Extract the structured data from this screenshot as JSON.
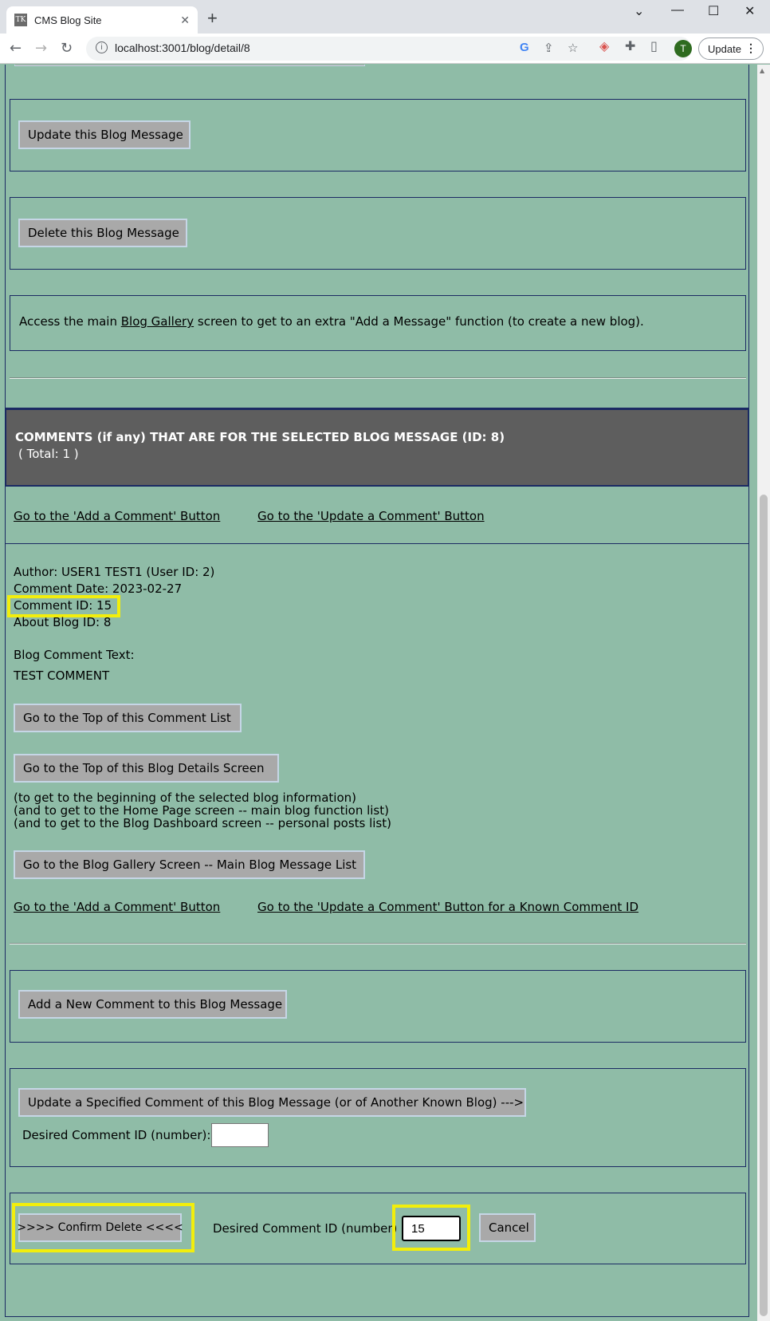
{
  "browser": {
    "tab_favicon": "TK",
    "tab_title": "CMS Blog Site",
    "tab_close": "✕",
    "new_tab": "+",
    "url": "localhost:3001/blog/detail/8",
    "profile_initial": "T",
    "update_label": "Update",
    "window_controls": [
      "⌄",
      "—",
      "☐",
      "✕"
    ]
  },
  "blog_actions": {
    "update_button": "Update this Blog Message",
    "delete_button": "Delete this Blog Message",
    "gallery_text_before": "Access the main ",
    "gallery_link": "Blog Gallery",
    "gallery_text_after": " screen to get to an extra \"Add a Message\" function (to create a new blog)."
  },
  "comments_header": {
    "title": "COMMENTS (if any) THAT ARE FOR THE SELECTED BLOG MESSAGE (ID: 8)",
    "total": "( Total: 1 )"
  },
  "top_links": {
    "add_comment": "Go to the 'Add a Comment' Button ",
    "update_comment": "Go to the 'Update a Comment' Button"
  },
  "comment": {
    "author": "Author: USER1 TEST1 (User ID: 2)",
    "date": "Comment Date: 2023-02-27",
    "comment_id": "Comment ID: 15",
    "blog_id": "About Blog ID: 8",
    "text_label": "Blog Comment Text:",
    "text": "TEST COMMENT"
  },
  "nav": {
    "top_of_comments": "Go to the Top of this Comment List",
    "top_of_blog": "Go to the Top of this Blog Details Screen",
    "note_1": "(to get to the beginning of the selected blog information)",
    "note_2": "(and to get to the Home Page screen -- main blog function list)",
    "note_3": "(and to get to the Blog Dashboard screen -- personal posts list)",
    "gallery_button": "Go to the Blog Gallery Screen -- Main Blog Message List"
  },
  "bottom_links": {
    "add_comment": "Go to the 'Add a Comment' Button ",
    "update_comment": "Go to the 'Update a Comment' Button for a Known Comment ID"
  },
  "add_comment": {
    "button": "Add a New Comment to this Blog Message"
  },
  "update_comment": {
    "button": "Update a Specified Comment of this Blog Message (or of Another Known Blog) --->",
    "id_label": "Desired Comment ID (number):",
    "id_value": ""
  },
  "delete_comment": {
    "confirm_button": ">>>>  Confirm Delete  <<<<",
    "id_label": "Desired Comment ID (number)",
    "id_value": "15",
    "cancel_button": "Cancel"
  },
  "colors": {
    "page_bg": "#8fbca7",
    "header_bg": "#5e5e5e",
    "frame_border": "#1b2a63",
    "button_bg": "#a9a9a9",
    "highlight": "#f2ee0c"
  }
}
